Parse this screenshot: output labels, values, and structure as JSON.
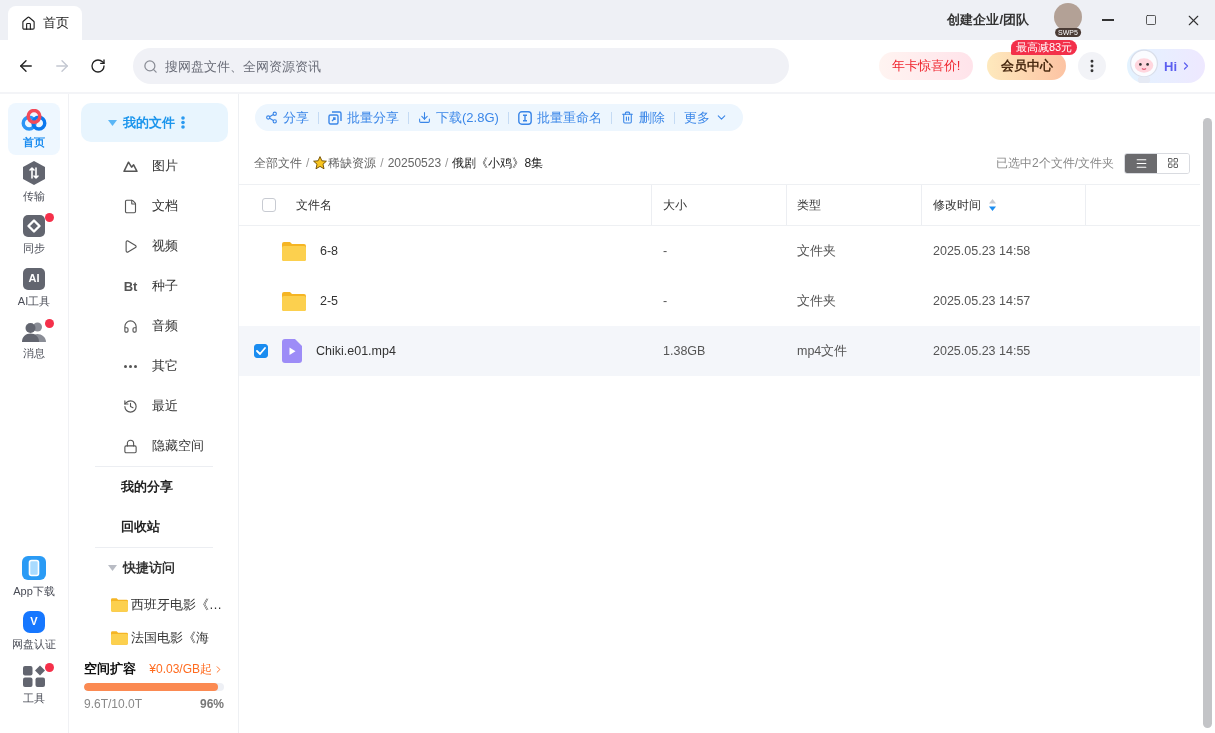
{
  "window": {
    "tabs": [
      {
        "label": "首页",
        "selected": true
      }
    ],
    "team_link": "创建企业/团队",
    "avatar_badge": "SWP5"
  },
  "nav": {
    "back": {
      "disabled": false
    },
    "forward": {
      "disabled": true
    },
    "search": {
      "placeholder": "搜网盘文件、全网资源资讯"
    },
    "promo": "年卡惊喜价!",
    "vip": {
      "label": "会员中心",
      "badge": "最高减83元"
    },
    "assistant": {
      "label": "Hi"
    }
  },
  "rail": {
    "items": [
      {
        "label": "首页",
        "selected": true,
        "unread": false
      },
      {
        "label": "传输",
        "selected": false,
        "unread": false
      },
      {
        "label": "同步",
        "selected": false,
        "unread": true
      },
      {
        "label": "AI工具",
        "glyph": "AI",
        "selected": false,
        "unread": false
      },
      {
        "label": "消息",
        "selected": false,
        "unread": true
      }
    ],
    "bottom_items": [
      {
        "label": "App下载",
        "selected": false,
        "unread": false
      },
      {
        "label": "网盘认证",
        "glyph": "V",
        "selected": false,
        "unread": false
      },
      {
        "label": "工具",
        "selected": false,
        "unread": true
      }
    ]
  },
  "sidebar": {
    "my_files": {
      "label": "我的文件",
      "selected": true,
      "expanded": true
    },
    "categories": [
      {
        "label": "图片",
        "selected": false
      },
      {
        "label": "文档",
        "selected": false
      },
      {
        "label": "视频",
        "selected": false
      },
      {
        "label": "种子",
        "glyph": "Bt",
        "selected": false
      },
      {
        "label": "音频",
        "selected": false
      },
      {
        "label": "其它",
        "selected": false
      },
      {
        "label": "最近",
        "selected": false
      },
      {
        "label": "隐藏空间",
        "selected": false
      }
    ],
    "links": [
      {
        "label": "我的分享",
        "selected": false
      },
      {
        "label": "回收站",
        "selected": false
      }
    ],
    "quick_access": {
      "label": "快捷访问",
      "expanded": true,
      "items": [
        {
          "label": "西班牙电影《…"
        },
        {
          "label": "法国电影《海"
        }
      ]
    },
    "storage": {
      "title": "空间扩容",
      "offer": "¥0.03/GB起",
      "level": 0.96,
      "used": "9.6T/10.0T",
      "percent": "96%"
    }
  },
  "toolbar": {
    "actions": [
      {
        "kind": "action",
        "label": "分享"
      },
      {
        "kind": "action",
        "label": "批量分享"
      },
      {
        "kind": "action",
        "label": "下载(2.8G)"
      },
      {
        "kind": "action",
        "label": "批量重命名"
      },
      {
        "kind": "action",
        "label": "删除"
      },
      {
        "kind": "menu",
        "label": "更多"
      }
    ]
  },
  "breadcrumb": {
    "items": [
      {
        "label": "全部文件",
        "separator": "/",
        "starred": false,
        "current": false
      },
      {
        "label": "稀缺资源",
        "separator": "/",
        "starred": true,
        "current": false
      },
      {
        "label": "20250523",
        "separator": "/",
        "starred": false,
        "current": false
      },
      {
        "label": "俄剧《小鸡》8集",
        "starred": false,
        "current": true
      }
    ]
  },
  "selection_summary": "已选中2个文件/文件夹",
  "view_modes": [
    {
      "kind": "list",
      "selected": true
    },
    {
      "kind": "grid",
      "selected": false
    }
  ],
  "table": {
    "select_all": {
      "checked": false
    },
    "columns": [
      {
        "label": "文件名"
      },
      {
        "label": "大小"
      },
      {
        "label": "类型"
      },
      {
        "label": "修改时间",
        "sorted": true,
        "descending": true
      }
    ],
    "rows": [
      {
        "kind": "folder",
        "name": "6-8",
        "size": "-",
        "type": "文件夹",
        "modified": "2025.05.23 14:58",
        "selected": false
      },
      {
        "kind": "folder",
        "name": "2-5",
        "size": "-",
        "type": "文件夹",
        "modified": "2025.05.23 14:57",
        "selected": false
      },
      {
        "kind": "video",
        "name": "Chiki.e01.mp4",
        "size": "1.38GB",
        "type": "mp4文件",
        "modified": "2025.05.23 14:55",
        "selected": true
      }
    ]
  }
}
